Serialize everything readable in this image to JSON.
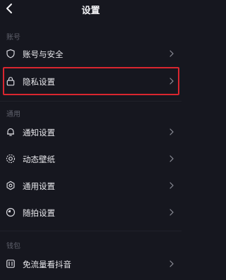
{
  "header": {
    "title": "设置"
  },
  "sections": {
    "account": {
      "label": "账号",
      "items": [
        {
          "label": "账号与安全",
          "icon": "shield-icon"
        },
        {
          "label": "隐私设置",
          "icon": "lock-icon"
        }
      ]
    },
    "general": {
      "label": "通用",
      "items": [
        {
          "label": "通知设置",
          "icon": "bell-icon"
        },
        {
          "label": "动态壁纸",
          "icon": "dynamic-wallpaper-icon"
        },
        {
          "label": "通用设置",
          "icon": "gear-icon"
        },
        {
          "label": "随拍设置",
          "icon": "camera-moment-icon"
        }
      ]
    },
    "wallet": {
      "label": "钱包",
      "items": [
        {
          "label": "免流量看抖音",
          "icon": "data-free-icon"
        }
      ]
    }
  },
  "colors": {
    "background": "#16171f",
    "highlight": "#d9262f",
    "section_label": "#5e606b"
  }
}
